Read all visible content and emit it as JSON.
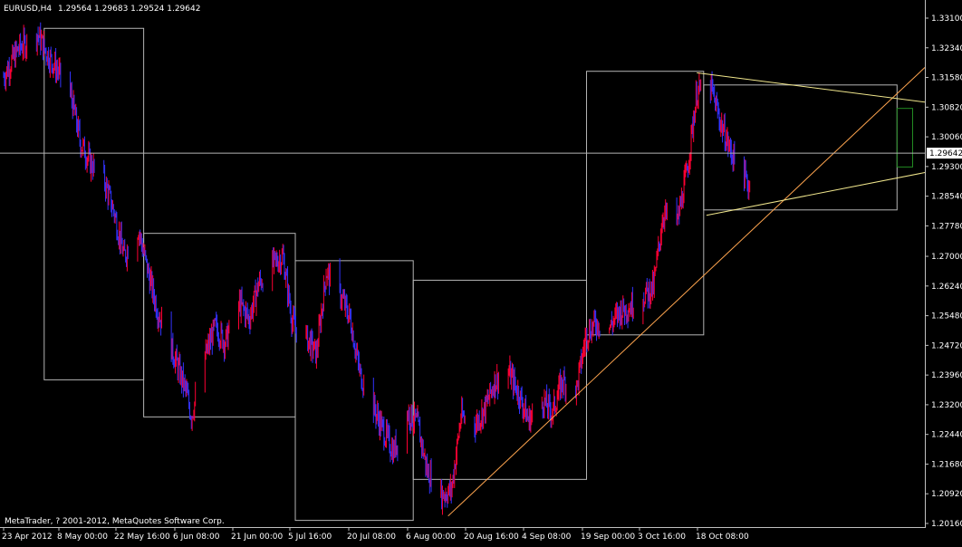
{
  "header": {
    "symbol_timeframe": "EURUSD,H4",
    "quote": "1.29564 1.29683 1.29524 1.29642"
  },
  "footer": {
    "copyright": "MetaTrader, ? 2001-2012, MetaQuotes Software Corp."
  },
  "colors": {
    "background": "#000000",
    "bull_candle": "#ff0033",
    "bear_candle": "#3333ff",
    "axis": "#c0c0c0",
    "text": "#ffffff",
    "rectangle": "#b4b4b4",
    "channel_lines": "#f0e68c",
    "trend_line": "#ffa54f",
    "box_green": "#228b22",
    "price_line": "#b4b4b4"
  },
  "chart_data": {
    "type": "candlestick",
    "symbol": "EURUSD",
    "timeframe": "H4",
    "ylim": [
      1.2016,
      1.331
    ],
    "xlim": [
      "2012-04-23 00:00",
      "2012-10-31 00:00"
    ],
    "y_ticks": [
      "1.33100",
      "1.32340",
      "1.31580",
      "1.30820",
      "1.30060",
      "1.29300",
      "1.28540",
      "1.27780",
      "1.27000",
      "1.26240",
      "1.25480",
      "1.24720",
      "1.23960",
      "1.23200",
      "1.22440",
      "1.21680",
      "1.20920",
      "1.20160"
    ],
    "x_ticks": [
      "23 Apr 2012",
      "8 May 00:00",
      "22 May 16:00",
      "6 Jun 08:00",
      "21 Jun 00:00",
      "5 Jul 16:00",
      "20 Jul 08:00",
      "6 Aug 00:00",
      "20 Aug 16:00",
      "4 Sep 08:00",
      "19 Sep 00:00",
      "3 Oct 16:00",
      "18 Oct 08:00"
    ],
    "current_price": 1.29642,
    "current_price_label": "1.29642",
    "close_path": [
      [
        "2012-04-23 00:00",
        1.316
      ],
      [
        "2012-04-26 00:00",
        1.323
      ],
      [
        "2012-04-30 00:00",
        1.327
      ],
      [
        "2012-05-02 00:00",
        1.322
      ],
      [
        "2012-05-04 00:00",
        1.318
      ],
      [
        "2012-05-07 00:00",
        1.311
      ],
      [
        "2012-05-09 00:00",
        1.299
      ],
      [
        "2012-05-11 00:00",
        1.294
      ],
      [
        "2012-05-14 00:00",
        1.289
      ],
      [
        "2012-05-16 00:00",
        1.281
      ],
      [
        "2012-05-18 00:00",
        1.27
      ],
      [
        "2012-05-21 00:00",
        1.277
      ],
      [
        "2012-05-23 00:00",
        1.266
      ],
      [
        "2012-05-25 00:00",
        1.256
      ],
      [
        "2012-05-28 00:00",
        1.246
      ],
      [
        "2012-05-31 00:00",
        1.235
      ],
      [
        "2012-06-01 00:00",
        1.229
      ],
      [
        "2012-06-04 00:00",
        1.245
      ],
      [
        "2012-06-06 00:00",
        1.252
      ],
      [
        "2012-06-08 00:00",
        1.248
      ],
      [
        "2012-06-11 00:00",
        1.258
      ],
      [
        "2012-06-13 00:00",
        1.254
      ],
      [
        "2012-06-15 00:00",
        1.263
      ],
      [
        "2012-06-18 00:00",
        1.268
      ],
      [
        "2012-06-20 00:00",
        1.27
      ],
      [
        "2012-06-22 00:00",
        1.253
      ],
      [
        "2012-06-25 00:00",
        1.249
      ],
      [
        "2012-06-27 00:00",
        1.245
      ],
      [
        "2012-06-29 00:00",
        1.266
      ],
      [
        "2012-07-02 00:00",
        1.26
      ],
      [
        "2012-07-04 00:00",
        1.254
      ],
      [
        "2012-07-06 00:00",
        1.24
      ],
      [
        "2012-07-09 00:00",
        1.231
      ],
      [
        "2012-07-11 00:00",
        1.225
      ],
      [
        "2012-07-13 00:00",
        1.22
      ],
      [
        "2012-07-16 00:00",
        1.23
      ],
      [
        "2012-07-18 00:00",
        1.227
      ],
      [
        "2012-07-20 00:00",
        1.215
      ],
      [
        "2012-07-23 00:00",
        1.209
      ],
      [
        "2012-07-25 00:00",
        1.21
      ],
      [
        "2012-07-27 00:00",
        1.229
      ],
      [
        "2012-07-30 00:00",
        1.227
      ],
      [
        "2012-08-01 00:00",
        1.231
      ],
      [
        "2012-08-03 00:00",
        1.238
      ],
      [
        "2012-08-06 00:00",
        1.24
      ],
      [
        "2012-08-08 00:00",
        1.235
      ],
      [
        "2012-08-10 00:00",
        1.228
      ],
      [
        "2012-08-13 00:00",
        1.233
      ],
      [
        "2012-08-15 00:00",
        1.23
      ],
      [
        "2012-08-17 00:00",
        1.238
      ],
      [
        "2012-08-20 00:00",
        1.236
      ],
      [
        "2012-08-22 00:00",
        1.25
      ],
      [
        "2012-08-24 00:00",
        1.253
      ],
      [
        "2012-08-27 00:00",
        1.252
      ],
      [
        "2012-08-29 00:00",
        1.256
      ],
      [
        "2012-08-31 00:00",
        1.257
      ],
      [
        "2012-09-03 00:00",
        1.26
      ],
      [
        "2012-09-05 00:00",
        1.262
      ],
      [
        "2012-09-07 00:00",
        1.281
      ],
      [
        "2012-09-10 00:00",
        1.279
      ],
      [
        "2012-09-12 00:00",
        1.292
      ],
      [
        "2012-09-14 00:00",
        1.312
      ],
      [
        "2012-09-17 00:00",
        1.313
      ],
      [
        "2012-09-19 00:00",
        1.304
      ],
      [
        "2012-09-21 00:00",
        1.297
      ],
      [
        "2012-09-24 00:00",
        1.29
      ],
      [
        "2012-09-26 00:00",
        1.285
      ],
      [
        "2012-09-28 00:00",
        1.288
      ],
      [
        "2012-10-01 00:00",
        1.292
      ],
      [
        "2012-10-03 00:00",
        1.289
      ],
      [
        "2012-10-05 00:00",
        1.302
      ],
      [
        "2012-10-08 00:00",
        1.297
      ],
      [
        "2012-10-10 00:00",
        1.287
      ],
      [
        "2012-10-12 00:00",
        1.294
      ],
      [
        "2012-10-15 00:00",
        1.298
      ],
      [
        "2012-10-17 00:00",
        1.312
      ],
      [
        "2012-10-19 00:00",
        1.309
      ],
      [
        "2012-10-22 00:00",
        1.303
      ],
      [
        "2012-10-24 00:00",
        1.297
      ],
      [
        "2012-10-26 00:00",
        1.293
      ],
      [
        "2012-10-29 00:00",
        1.296
      ],
      [
        "2012-10-30 08:00",
        1.29642
      ]
    ],
    "rectangles": [
      {
        "t1": "2012-05-01 08:00",
        "t2": "2012-05-22 00:00",
        "p1": 1.3285,
        "p2": 1.2385
      },
      {
        "t1": "2012-05-22 00:00",
        "t2": "2012-06-22 12:00",
        "p1": 1.276,
        "p2": 1.229
      },
      {
        "t1": "2012-06-22 12:00",
        "t2": "2012-07-17 00:00",
        "p1": 1.269,
        "p2": 1.2025
      },
      {
        "t1": "2012-07-17 00:00",
        "t2": "2012-08-22 00:00",
        "p1": 1.264,
        "p2": 1.213
      },
      {
        "t1": "2012-08-22 00:00",
        "t2": "2012-09-15 08:00",
        "p1": 1.3175,
        "p2": 1.25
      },
      {
        "t1": "2012-09-15 08:00",
        "t2": "2012-10-25 12:00",
        "p1": 1.314,
        "p2": 1.282
      },
      {
        "t1": "2012-10-25 12:00",
        "t2": "2012-11-10 00:00",
        "p1": 1.308,
        "p2": 1.293
      }
    ],
    "trend_lines": [
      {
        "role": "trend",
        "t1": "2012-07-24 08:00",
        "p1": 1.2035,
        "t2": "2012-11-13 00:00",
        "p2": 1.333
      },
      {
        "role": "channel-upper",
        "t1": "2012-09-14 00:00",
        "p1": 1.317,
        "t2": "2012-11-13 00:00",
        "p2": 1.3075
      },
      {
        "role": "channel-lower",
        "t1": "2012-09-16 00:00",
        "p1": 1.2805,
        "t2": "2012-11-13 00:00",
        "p2": 1.2945
      }
    ]
  }
}
